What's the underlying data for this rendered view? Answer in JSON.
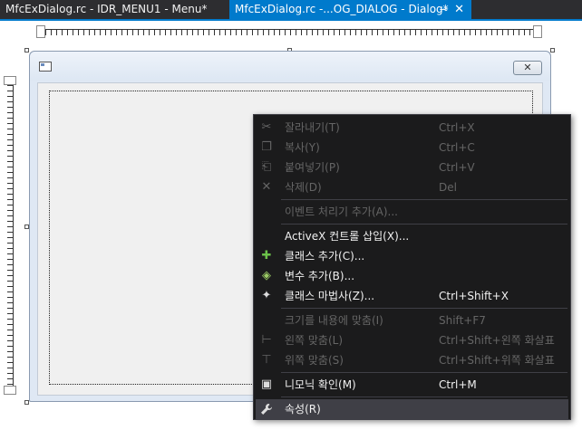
{
  "tabs": [
    {
      "label": "MfcExDialog.rc - IDR_MENU1 - Menu*",
      "active": false
    },
    {
      "label": "MfcExDialog.rc -...OG_DIALOG - Dialog*",
      "active": true
    }
  ],
  "tab_icons": {
    "pin": "pin-icon",
    "close": "close-icon"
  },
  "dialog": {
    "close_glyph": "✕"
  },
  "context_menu": {
    "items": [
      {
        "label": "잘라내기(T)",
        "shortcut": "Ctrl+X",
        "icon": "✂",
        "icon_name": "scissors-icon",
        "enabled": false
      },
      {
        "label": "복사(Y)",
        "shortcut": "Ctrl+C",
        "icon": "❐",
        "icon_name": "copy-icon",
        "enabled": false
      },
      {
        "label": "붙여넣기(P)",
        "shortcut": "Ctrl+V",
        "icon": "⎗",
        "icon_name": "paste-icon",
        "enabled": false
      },
      {
        "label": "삭제(D)",
        "shortcut": "Del",
        "icon": "✕",
        "icon_name": "delete-icon",
        "enabled": false
      },
      {
        "label": "이벤트 처리기 추가(A)...",
        "shortcut": "",
        "icon": "",
        "icon_name": "",
        "enabled": false
      },
      {
        "label": "ActiveX 컨트롤 삽입(X)...",
        "shortcut": "",
        "icon": "",
        "icon_name": "",
        "enabled": true
      },
      {
        "label": "클래스 추가(C)...",
        "shortcut": "",
        "icon": "✚",
        "icon_name": "add-class-icon",
        "enabled": true
      },
      {
        "label": "변수 추가(B)...",
        "shortcut": "",
        "icon": "◈",
        "icon_name": "add-variable-icon",
        "enabled": true
      },
      {
        "label": "클래스 마법사(Z)...",
        "shortcut": "Ctrl+Shift+X",
        "icon": "✦",
        "icon_name": "class-wizard-icon",
        "enabled": true
      },
      {
        "label": "크기를 내용에 맞춤(I)",
        "shortcut": "Shift+F7",
        "icon": "",
        "icon_name": "",
        "enabled": false
      },
      {
        "label": "왼쪽 맞춤(L)",
        "shortcut": "Ctrl+Shift+왼쪽 화살표",
        "icon": "⊢",
        "icon_name": "align-left-icon",
        "enabled": false
      },
      {
        "label": "위쪽 맞춤(S)",
        "shortcut": "Ctrl+Shift+위쪽 화살표",
        "icon": "⊤",
        "icon_name": "align-top-icon",
        "enabled": false
      },
      {
        "label": "니모닉 확인(M)",
        "shortcut": "Ctrl+M",
        "icon": "▣",
        "icon_name": "check-mnemonics-icon",
        "enabled": true
      },
      {
        "label": "속성(R)",
        "shortcut": "",
        "icon": "🔧",
        "icon_name": "wrench-icon",
        "enabled": true
      }
    ]
  }
}
